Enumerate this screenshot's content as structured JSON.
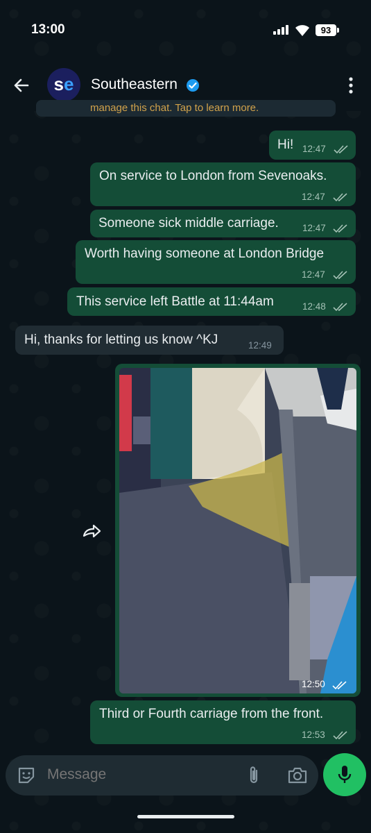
{
  "status_bar": {
    "time": "13:00",
    "battery": "93"
  },
  "header": {
    "contact_name": "Southeastern",
    "avatar_text_s": "s",
    "avatar_text_e": "e"
  },
  "system_notice": {
    "text": "manage this chat. Tap to learn more."
  },
  "messages": [
    {
      "direction": "out",
      "text": "Hi!",
      "time": "12:47"
    },
    {
      "direction": "out",
      "text": "On service to London from Sevenoaks.",
      "time": "12:47"
    },
    {
      "direction": "out",
      "text": "Someone sick middle carriage.",
      "time": "12:47"
    },
    {
      "direction": "out",
      "text": "Worth having someone at London Bridge",
      "time": "12:47"
    },
    {
      "direction": "out",
      "text": "This service left Battle at 11:44am",
      "time": "12:48"
    },
    {
      "direction": "in",
      "text": "Hi, thanks for letting us know ^KJ",
      "time": "12:49"
    },
    {
      "direction": "out",
      "type": "image",
      "time": "12:50"
    },
    {
      "direction": "out",
      "text": "Third or Fourth carriage from the front.",
      "time": "12:53"
    }
  ],
  "composer": {
    "placeholder": "Message"
  },
  "icons": {
    "back": "back-arrow-icon",
    "verified": "verified-badge-icon",
    "menu": "more-vert-icon",
    "sticker": "sticker-icon",
    "attach": "paperclip-icon",
    "camera": "camera-icon",
    "mic": "microphone-icon",
    "forward": "forward-icon",
    "read": "double-check-icon"
  },
  "colors": {
    "outgoing_bubble": "#144d37",
    "incoming_bubble": "#202c33",
    "accent": "#21c063",
    "background": "#0b141a"
  }
}
